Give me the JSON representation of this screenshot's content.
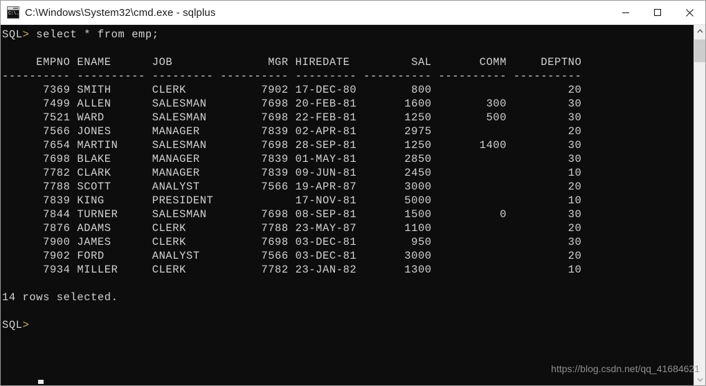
{
  "window": {
    "title": "C:\\Windows\\System32\\cmd.exe - sqlplus",
    "icon_name": "cmd-exe-icon",
    "icon_glyph": "C:\\.",
    "background_color": "#0d0d0d",
    "text_color": "#d2d2d2",
    "titlebar_color": "#ffffff",
    "controls": {
      "minimize_label": "Minimize",
      "maximize_label": "Maximize",
      "close_label": "Close"
    }
  },
  "terminal": {
    "prompt": "SQL>",
    "command": "select * from emp;",
    "prompt_line": "SQL> select * from emp;",
    "blank_line": "",
    "columns": [
      {
        "name": "EMPNO",
        "width": 10,
        "align": "right",
        "underline": "----------"
      },
      {
        "name": "ENAME",
        "width": 10,
        "align": "left",
        "underline": "----------"
      },
      {
        "name": "JOB",
        "width": 9,
        "align": "left",
        "underline": "---------"
      },
      {
        "name": "MGR",
        "width": 10,
        "align": "right",
        "underline": "----------"
      },
      {
        "name": "HIREDATE",
        "width": 9,
        "align": "left",
        "underline": "---------"
      },
      {
        "name": "SAL",
        "width": 10,
        "align": "right",
        "underline": "----------"
      },
      {
        "name": "COMM",
        "width": 10,
        "align": "right",
        "underline": "----------"
      },
      {
        "name": "DEPTNO",
        "width": 10,
        "align": "right",
        "underline": "----------"
      }
    ],
    "header_line": "     EMPNO ENAME      JOB              MGR HIREDATE         SAL       COMM     DEPTNO",
    "separator_line": "---------- ---------- --------- ---------- --------- ---------- ---------- ----------",
    "rows": [
      {
        "EMPNO": "7369",
        "ENAME": "SMITH",
        "JOB": "CLERK",
        "MGR": "7902",
        "HIREDATE": "17-DEC-80",
        "SAL": "800",
        "COMM": "",
        "DEPTNO": "20"
      },
      {
        "EMPNO": "7499",
        "ENAME": "ALLEN",
        "JOB": "SALESMAN",
        "MGR": "7698",
        "HIREDATE": "20-FEB-81",
        "SAL": "1600",
        "COMM": "300",
        "DEPTNO": "30"
      },
      {
        "EMPNO": "7521",
        "ENAME": "WARD",
        "JOB": "SALESMAN",
        "MGR": "7698",
        "HIREDATE": "22-FEB-81",
        "SAL": "1250",
        "COMM": "500",
        "DEPTNO": "30"
      },
      {
        "EMPNO": "7566",
        "ENAME": "JONES",
        "JOB": "MANAGER",
        "MGR": "7839",
        "HIREDATE": "02-APR-81",
        "SAL": "2975",
        "COMM": "",
        "DEPTNO": "20"
      },
      {
        "EMPNO": "7654",
        "ENAME": "MARTIN",
        "JOB": "SALESMAN",
        "MGR": "7698",
        "HIREDATE": "28-SEP-81",
        "SAL": "1250",
        "COMM": "1400",
        "DEPTNO": "30"
      },
      {
        "EMPNO": "7698",
        "ENAME": "BLAKE",
        "JOB": "MANAGER",
        "MGR": "7839",
        "HIREDATE": "01-MAY-81",
        "SAL": "2850",
        "COMM": "",
        "DEPTNO": "30"
      },
      {
        "EMPNO": "7782",
        "ENAME": "CLARK",
        "JOB": "MANAGER",
        "MGR": "7839",
        "HIREDATE": "09-JUN-81",
        "SAL": "2450",
        "COMM": "",
        "DEPTNO": "10"
      },
      {
        "EMPNO": "7788",
        "ENAME": "SCOTT",
        "JOB": "ANALYST",
        "MGR": "7566",
        "HIREDATE": "19-APR-87",
        "SAL": "3000",
        "COMM": "",
        "DEPTNO": "20"
      },
      {
        "EMPNO": "7839",
        "ENAME": "KING",
        "JOB": "PRESIDENT",
        "MGR": "",
        "HIREDATE": "17-NOV-81",
        "SAL": "5000",
        "COMM": "",
        "DEPTNO": "10"
      },
      {
        "EMPNO": "7844",
        "ENAME": "TURNER",
        "JOB": "SALESMAN",
        "MGR": "7698",
        "HIREDATE": "08-SEP-81",
        "SAL": "1500",
        "COMM": "0",
        "DEPTNO": "30"
      },
      {
        "EMPNO": "7876",
        "ENAME": "ADAMS",
        "JOB": "CLERK",
        "MGR": "7788",
        "HIREDATE": "23-MAY-87",
        "SAL": "1100",
        "COMM": "",
        "DEPTNO": "20"
      },
      {
        "EMPNO": "7900",
        "ENAME": "JAMES",
        "JOB": "CLERK",
        "MGR": "7698",
        "HIREDATE": "03-DEC-81",
        "SAL": "950",
        "COMM": "",
        "DEPTNO": "30"
      },
      {
        "EMPNO": "7902",
        "ENAME": "FORD",
        "JOB": "ANALYST",
        "MGR": "7566",
        "HIREDATE": "03-DEC-81",
        "SAL": "3000",
        "COMM": "",
        "DEPTNO": "20"
      },
      {
        "EMPNO": "7934",
        "ENAME": "MILLER",
        "JOB": "CLERK",
        "MGR": "7782",
        "HIREDATE": "23-JAN-82",
        "SAL": "1300",
        "COMM": "",
        "DEPTNO": "10"
      }
    ],
    "row_count_message": "14 rows selected.",
    "final_prompt": "SQL>"
  },
  "scrollbar": {
    "up_arrow_name": "scroll-up-arrow",
    "down_arrow_name": "scroll-down-arrow",
    "thumb_name": "scrollbar-thumb"
  },
  "watermark": {
    "text": "https://blog.csdn.net/qq_41684621"
  }
}
